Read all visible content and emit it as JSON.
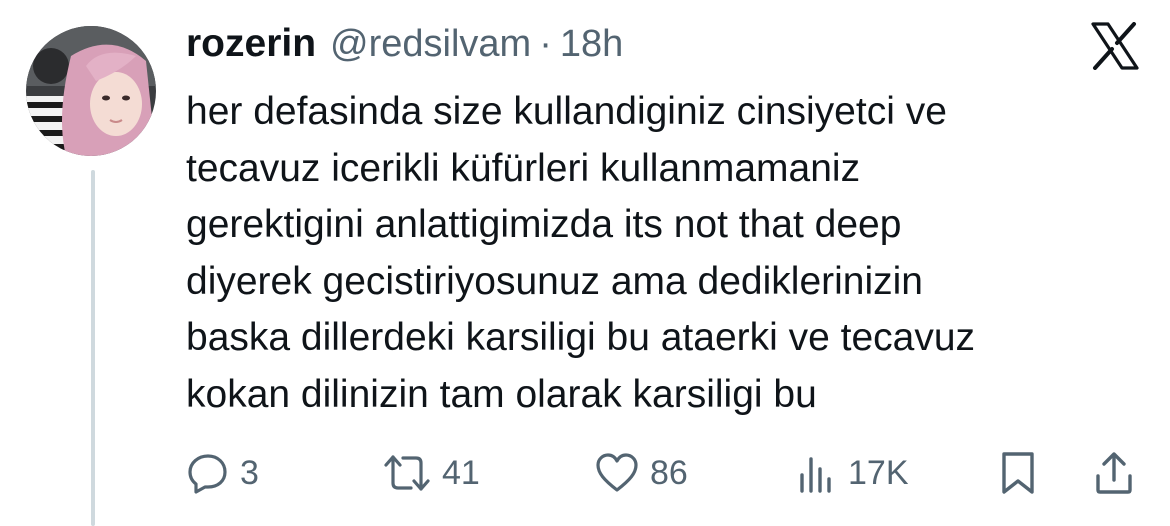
{
  "tweet": {
    "author_name": "rozerin",
    "handle": "@redsilvam",
    "separator": "·",
    "time": "18h",
    "lines": [
      "her defasinda size kullandiginiz cinsiyetci ve",
      "tecavuz icerikli küfürleri kullanmamaniz",
      "gerektigini anlattigimizda its not that deep",
      "diyerek gecistiriyosunuz ama dediklerinizin",
      "baska dillerdeki karsiligi bu ataerki ve tecavuz",
      "kokan dilinizin tam olarak karsiligi bu"
    ]
  },
  "actions": {
    "replies": "3",
    "reposts": "41",
    "likes": "86",
    "views": "17K"
  },
  "icons": {
    "brand": "x-logo-icon",
    "reply": "reply-icon",
    "repost": "repost-icon",
    "like": "heart-icon",
    "views": "views-icon",
    "bookmark": "bookmark-icon",
    "share": "share-icon"
  },
  "colors": {
    "text": "#0f1419",
    "secondary": "#536471",
    "thread_line": "#cfd9de"
  }
}
